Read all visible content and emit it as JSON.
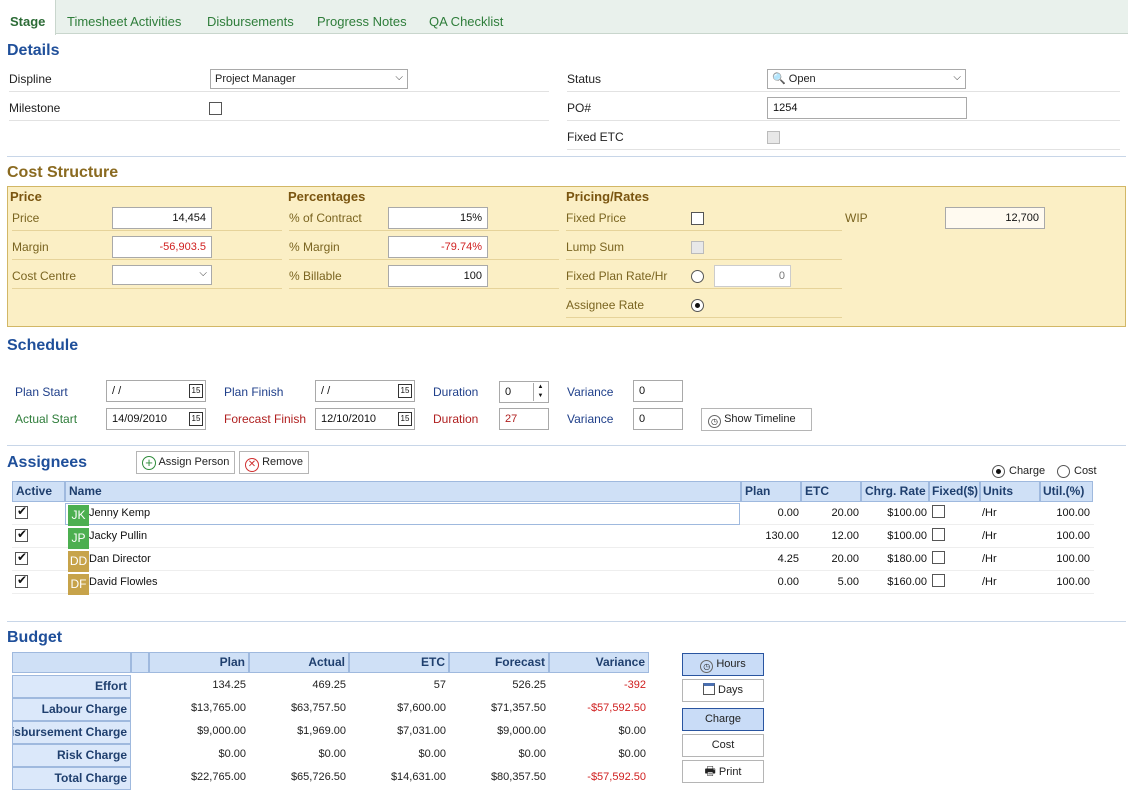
{
  "tabs": [
    "Stage",
    "Timesheet Activities",
    "Disbursements",
    "Progress Notes",
    "QA Checklist"
  ],
  "details": {
    "title": "Details",
    "discipline_label": "Displine",
    "discipline_value": "Project Manager",
    "milestone_label": "Milestone",
    "status_label": "Status",
    "status_value": "Open",
    "po_label": "PO#",
    "po_value": "1254",
    "fixed_etc_label": "Fixed ETC"
  },
  "cost": {
    "title": "Cost Structure",
    "price_heading": "Price",
    "price_label": "Price",
    "price_value": "14,454",
    "margin_label": "Margin",
    "margin_value": "-56,903.5",
    "cost_centre_label": "Cost Centre",
    "pct_heading": "Percentages",
    "pct_contract_label": "% of Contract",
    "pct_contract_value": "15%",
    "pct_margin_label": "% Margin",
    "pct_margin_value": "-79.74%",
    "pct_billable_label": "% Billable",
    "pct_billable_value": "100",
    "pricing_heading": "Pricing/Rates",
    "fixed_price_label": "Fixed Price",
    "lump_sum_label": "Lump Sum",
    "fixed_plan_rate_label": "Fixed Plan Rate/Hr",
    "fixed_plan_rate_value": "0",
    "assignee_rate_label": "Assignee Rate",
    "wip_label": "WIP",
    "wip_value": "12,700"
  },
  "schedule": {
    "title": "Schedule",
    "plan_start_label": "Plan Start",
    "plan_start_value": "/ /",
    "plan_finish_label": "Plan Finish",
    "plan_finish_value": "/ /",
    "duration1_label": "Duration",
    "duration1_value": "0",
    "variance1_label": "Variance",
    "variance1_value": "0",
    "actual_start_label": "Actual Start",
    "actual_start_value": "14/09/2010",
    "forecast_finish_label": "Forecast Finish",
    "forecast_finish_value": "12/10/2010",
    "duration2_label": "Duration",
    "duration2_value": "27",
    "variance2_label": "Variance",
    "variance2_value": "0",
    "show_timeline": "Show Timeline",
    "cal_glyph": "15"
  },
  "assignees": {
    "title": "Assignees",
    "assign_btn": "Assign Person",
    "remove_btn": "Remove",
    "charge_label": "Charge",
    "cost_label": "Cost",
    "columns": [
      "Active",
      "Name",
      "Plan",
      "ETC",
      "Chrg. Rate",
      "Fixed($)",
      "Units",
      "Util.(%)"
    ],
    "rows": [
      {
        "initials": "JK",
        "color": "#4caf50",
        "name": "Jenny Kemp",
        "plan": "0.00",
        "etc": "20.00",
        "rate": "$100.00",
        "units": "/Hr",
        "util": "100.00"
      },
      {
        "initials": "JP",
        "color": "#4caf50",
        "name": "Jacky Pullin",
        "plan": "130.00",
        "etc": "12.00",
        "rate": "$100.00",
        "units": "/Hr",
        "util": "100.00"
      },
      {
        "initials": "DD",
        "color": "#c7a34a",
        "name": "Dan Director",
        "plan": "4.25",
        "etc": "20.00",
        "rate": "$180.00",
        "units": "/Hr",
        "util": "100.00"
      },
      {
        "initials": "DF",
        "color": "#c7a34a",
        "name": "David Flowles",
        "plan": "0.00",
        "etc": "5.00",
        "rate": "$160.00",
        "units": "/Hr",
        "util": "100.00"
      }
    ]
  },
  "budget": {
    "title": "Budget",
    "columns": [
      "Plan",
      "Actual",
      "ETC",
      "Forecast",
      "Variance"
    ],
    "rows": [
      {
        "label": "Effort",
        "values": [
          "134.25",
          "469.25",
          "57",
          "526.25",
          "-392"
        ]
      },
      {
        "label": "Labour Charge",
        "values": [
          "$13,765.00",
          "$63,757.50",
          "$7,600.00",
          "$71,357.50",
          "-$57,592.50"
        ]
      },
      {
        "label": "Disbursement Charge",
        "values": [
          "$9,000.00",
          "$1,969.00",
          "$7,031.00",
          "$9,000.00",
          "$0.00"
        ]
      },
      {
        "label": "Risk Charge",
        "values": [
          "$0.00",
          "$0.00",
          "$0.00",
          "$0.00",
          "$0.00"
        ]
      },
      {
        "label": "Total Charge",
        "values": [
          "$22,765.00",
          "$65,726.50",
          "$14,631.00",
          "$80,357.50",
          "-$57,592.50"
        ]
      }
    ],
    "hours_btn": "Hours",
    "days_btn": "Days",
    "charge_btn": "Charge",
    "cost_btn": "Cost",
    "print_btn": "Print"
  }
}
